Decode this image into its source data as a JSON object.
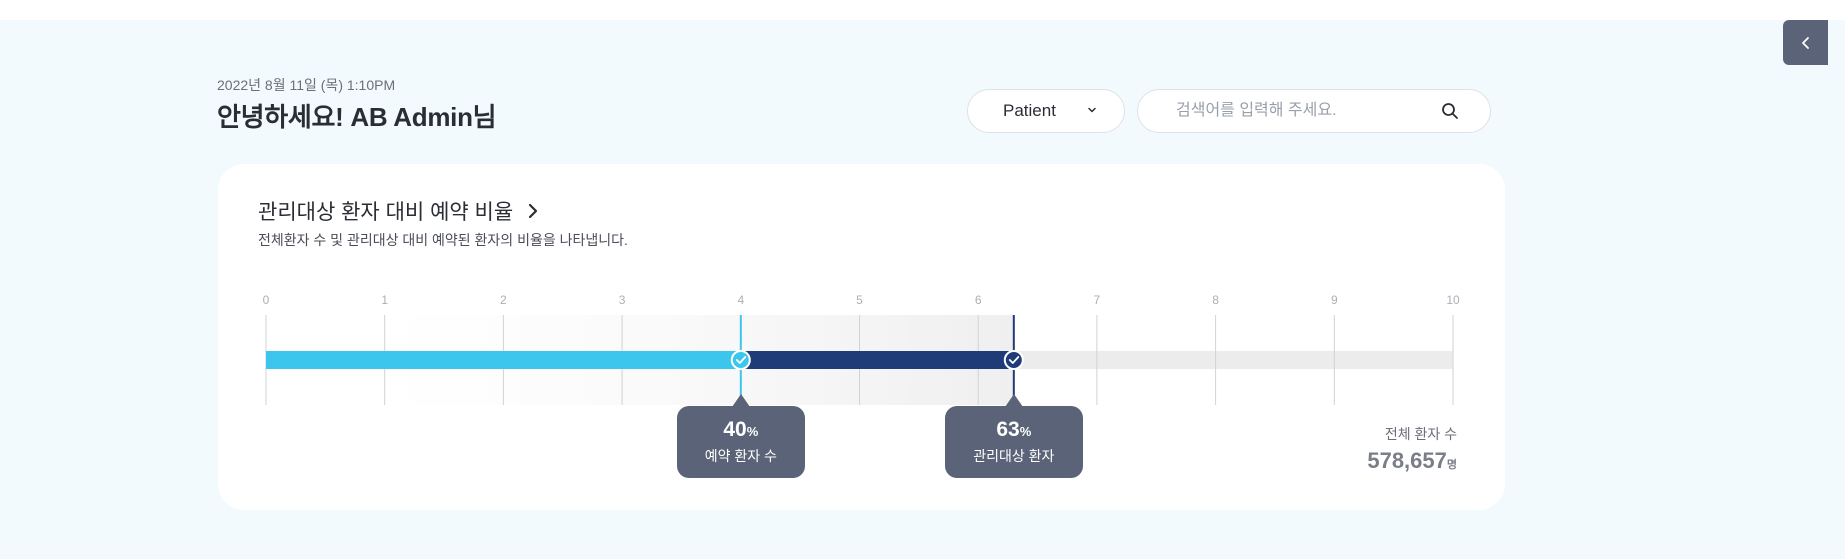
{
  "header": {
    "datetime": "2022년 8월 11일 (목) 1:10PM",
    "greeting": "안녕하세요! AB Admin님"
  },
  "filter": {
    "selected": "Patient"
  },
  "search": {
    "placeholder": "검색어를 입력해 주세요."
  },
  "card": {
    "title": "관리대상 환자 대비 예약 비율",
    "description": "전체환자 수 및 관리대상 대비 예약된 환자의 비율을 나타냅니다."
  },
  "chart_data": {
    "type": "bar",
    "x_ticks": [
      "0",
      "1",
      "2",
      "3",
      "4",
      "5",
      "6",
      "7",
      "8",
      "9",
      "10"
    ],
    "xlim": [
      0,
      10
    ],
    "series": [
      {
        "name": "예약 환자 수",
        "value": 40,
        "unit": "%",
        "color": "#3cc6ee"
      },
      {
        "name": "관리대상 환자",
        "value": 63,
        "unit": "%",
        "color": "#1f3b78"
      }
    ],
    "track_color": "#ececec"
  },
  "tooltips": [
    {
      "pct": "40",
      "unit": "%",
      "label": "예약 환자 수"
    },
    {
      "pct": "63",
      "unit": "%",
      "label": "관리대상 환자"
    }
  ],
  "total": {
    "label": "전체 환자 수",
    "value": "578,657",
    "unit": "명"
  },
  "colors": {
    "background": "#f2fafd",
    "accent_light": "#3cc6ee",
    "accent_dark": "#1f3b78",
    "tooltip": "#5a6378"
  }
}
